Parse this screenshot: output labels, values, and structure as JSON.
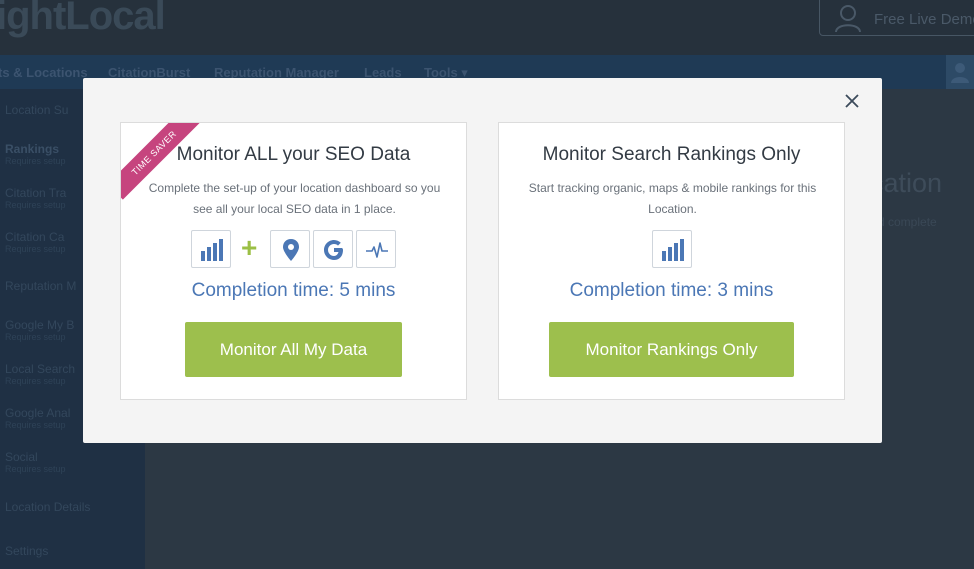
{
  "app": {
    "logo_text": "ightLocal",
    "demo_label": "Free Live Demo"
  },
  "nav": {
    "items": [
      "ts & Locations",
      "CitationBurst",
      "Reputation Manager",
      "Leads",
      "Tools ▾"
    ]
  },
  "sidebar": {
    "items": [
      {
        "label": "Location Su",
        "sub": ""
      },
      {
        "label": "Rankings",
        "sub": "Requires setup"
      },
      {
        "label": "Citation Tra",
        "sub": "Requires setup"
      },
      {
        "label": "Citation Ca",
        "sub": "Requires setup"
      },
      {
        "label": "Reputation M",
        "sub": ""
      },
      {
        "label": "Google My B",
        "sub": "Requires setup"
      },
      {
        "label": "Local Search",
        "sub": "Requires setup"
      },
      {
        "label": "Google Anal",
        "sub": "Requires setup"
      },
      {
        "label": "Social",
        "sub": "Requires setup"
      },
      {
        "label": "Location Details",
        "sub": ""
      },
      {
        "label": "Settings",
        "sub": ""
      }
    ]
  },
  "background": {
    "heading": "cation",
    "sub": "d complete"
  },
  "modal": {
    "left": {
      "ribbon": "TIME SAVER",
      "title": "Monitor ALL your SEO Data",
      "description": "Complete the set-up of your location dashboard so you see all your local SEO data in 1 place.",
      "icons": [
        "bar-chart-icon",
        "map-pin-icon",
        "google-g-icon",
        "pulse-icon"
      ],
      "completion": "Completion time: 5 mins",
      "button": "Monitor All My Data"
    },
    "right": {
      "title": "Monitor Search Rankings Only",
      "description": "Start tracking organic, maps & mobile rankings for this Location.",
      "icons": [
        "bar-chart-icon"
      ],
      "completion": "Completion time: 3 mins",
      "button": "Monitor Rankings Only"
    }
  },
  "colors": {
    "accent_green": "#9dbf4d",
    "accent_blue": "#4b77b5",
    "ribbon_pink": "#c6447e"
  }
}
